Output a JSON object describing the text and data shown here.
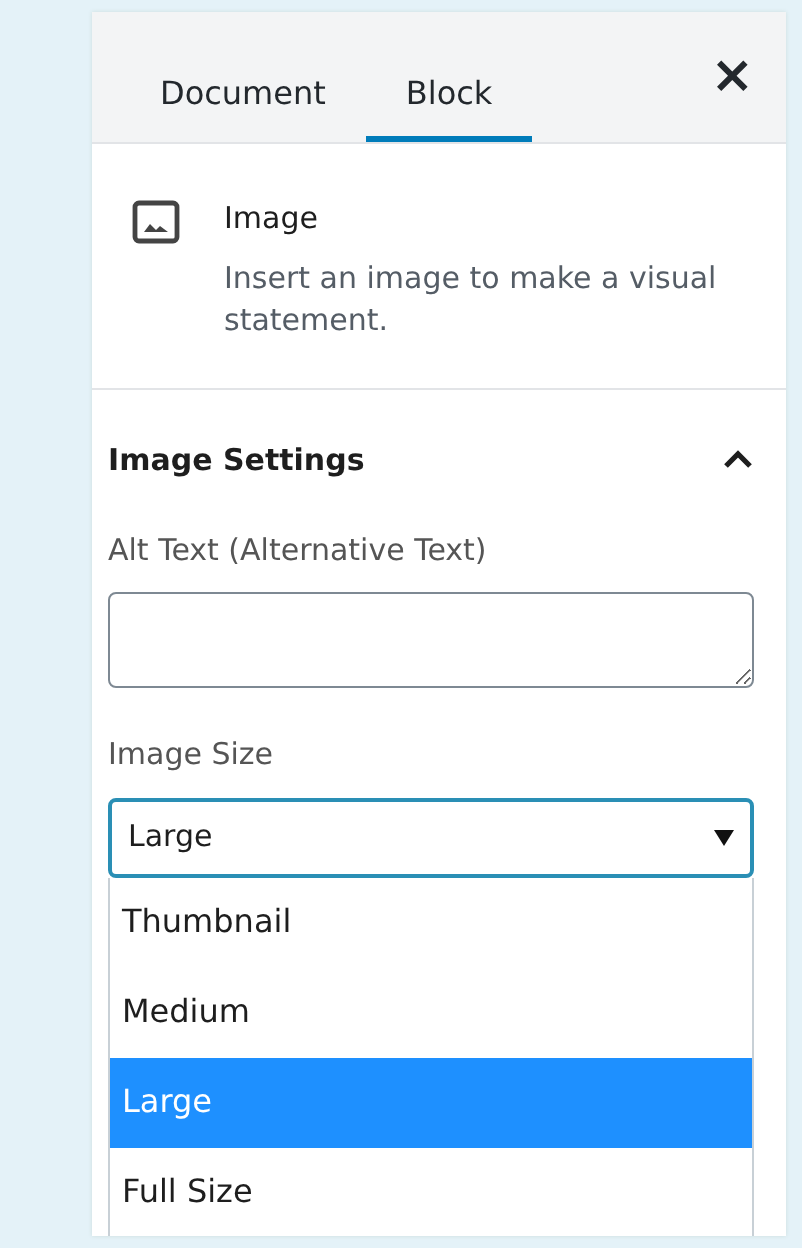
{
  "tabs": [
    {
      "label": "Document",
      "selected": false
    },
    {
      "label": "Block",
      "selected": true
    }
  ],
  "close": {
    "label": "×"
  },
  "block": {
    "title": "Image",
    "description": "Insert an image to make a visual statement."
  },
  "settings": {
    "title": "Image Settings",
    "expanded": true,
    "alt_text": {
      "label": "Alt Text (Alternative Text)"
    },
    "image_size": {
      "label": "Image Size",
      "value": "Large",
      "open": true,
      "options": [
        {
          "label": "Thumbnail",
          "selected": false
        },
        {
          "label": "Medium",
          "selected": false
        },
        {
          "label": "Large",
          "selected": true
        },
        {
          "label": "Full Size",
          "selected": false
        }
      ]
    }
  }
}
